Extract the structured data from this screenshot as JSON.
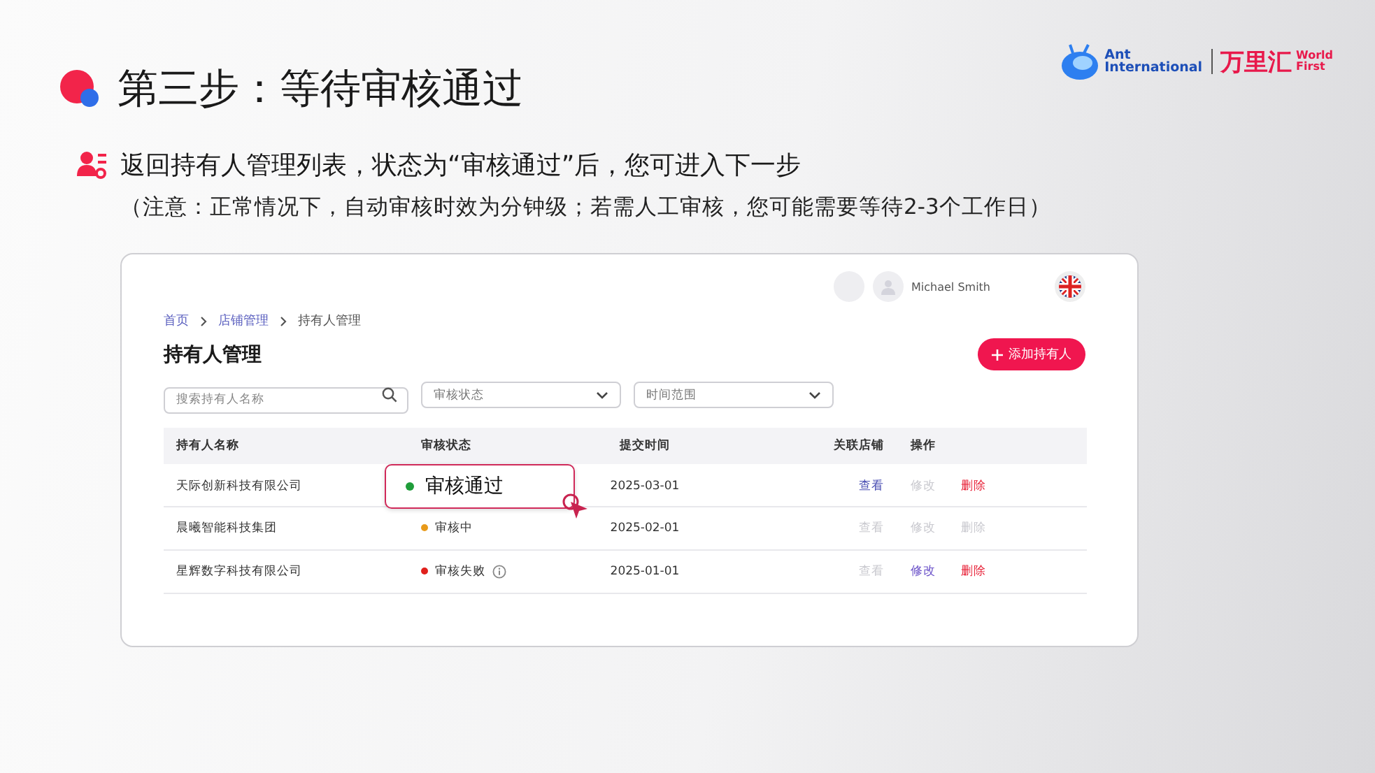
{
  "logo": {
    "brand_en": [
      "Ant",
      "International"
    ],
    "brand_cn": "万里汇",
    "brand_wf": [
      "World",
      "First"
    ]
  },
  "title": "第三步：等待审核通过",
  "instruction": "返回持有人管理列表，状态为“审核通过”后，您可进入下一步",
  "note": "（注意：正常情况下，自动审核时效为分钟级；若需人工审核，您可能需要等待2-3个工作日）",
  "app": {
    "user": "Michael Smith",
    "breadcrumb": [
      {
        "label": "首页",
        "current": false
      },
      {
        "label": "店铺管理",
        "current": false
      },
      {
        "label": "持有人管理",
        "current": true
      }
    ],
    "page_title": "持有人管理",
    "add_button": "添加持有人",
    "search": {
      "placeholder": "搜索持有人名称"
    },
    "filters": [
      {
        "placeholder": "审核状态"
      },
      {
        "placeholder": "时间范围"
      }
    ],
    "columns": [
      "持有人名称",
      "审核状态",
      "提交时间",
      "关联店铺",
      "操作"
    ],
    "rows": [
      {
        "name": "天际创新科技有限公司",
        "status": "审核通过",
        "color": "#1f9d3a",
        "highlighted": true,
        "info": false,
        "time": "2025-03-01",
        "actions": [
          {
            "label": "查看",
            "kind": "view",
            "disabled": false
          },
          {
            "label": "修改",
            "kind": "edit",
            "disabled": true
          },
          {
            "label": "删除",
            "kind": "delete",
            "disabled": false
          }
        ]
      },
      {
        "name": "晨曦智能科技集团",
        "status": "审核中",
        "color": "#e89a1a",
        "highlighted": false,
        "info": false,
        "time": "2025-02-01",
        "actions": [
          {
            "label": "查看",
            "kind": "view",
            "disabled": true
          },
          {
            "label": "修改",
            "kind": "edit",
            "disabled": true
          },
          {
            "label": "删除",
            "kind": "delete",
            "disabled": true
          }
        ]
      },
      {
        "name": "星辉数字科技有限公司",
        "status": "审核失败",
        "color": "#e0201c",
        "highlighted": false,
        "info": true,
        "time": "2025-01-01",
        "actions": [
          {
            "label": "查看",
            "kind": "view",
            "disabled": true
          },
          {
            "label": "修改",
            "kind": "edit",
            "disabled": false
          },
          {
            "label": "删除",
            "kind": "delete",
            "disabled": false
          }
        ]
      }
    ]
  }
}
